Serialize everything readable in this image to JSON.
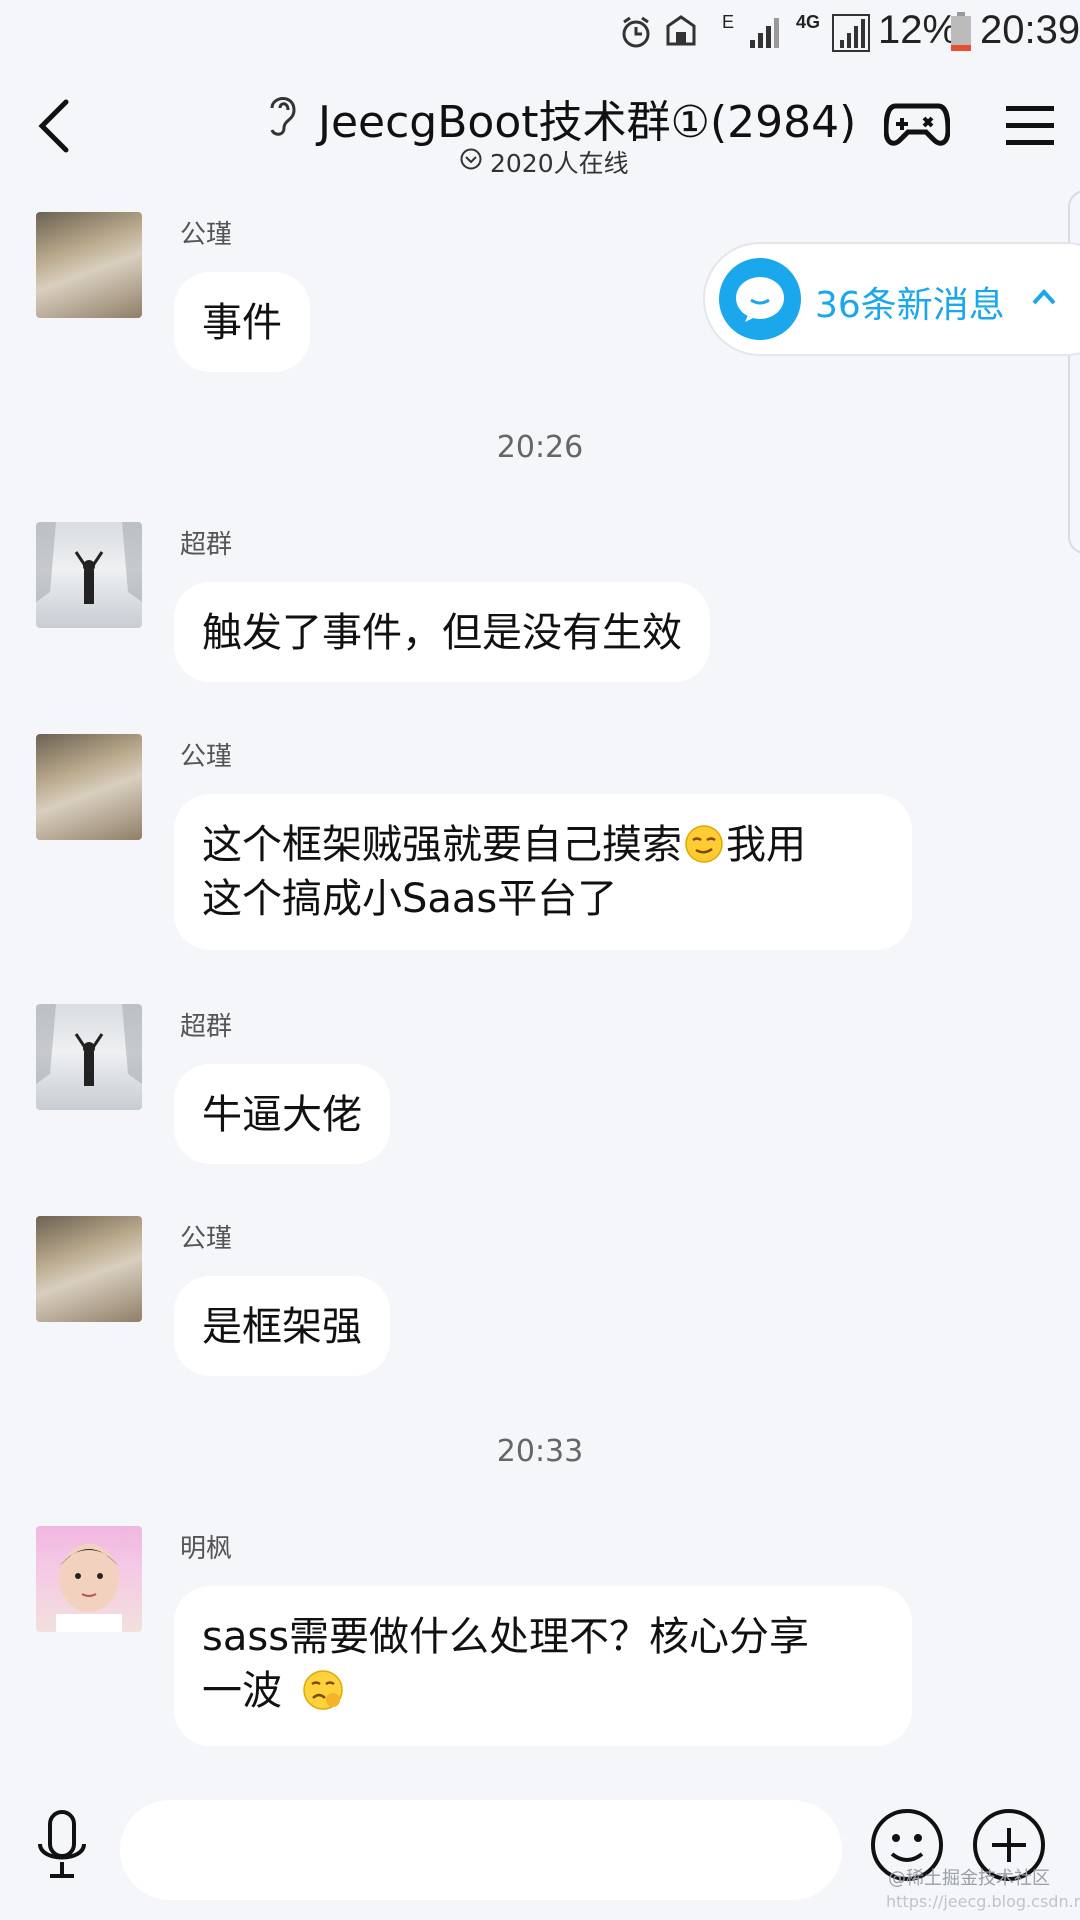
{
  "status_bar": {
    "battery": "12%",
    "time": "20:39",
    "network_e": "E",
    "network_4g": "4G"
  },
  "header": {
    "title": "JeecgBoot技术群①(2984)",
    "online": "2020人在线"
  },
  "new_messages": {
    "label": "36条新消息"
  },
  "messages": [
    {
      "sender": "公瑾",
      "text": "事件"
    },
    {
      "time": "20:26"
    },
    {
      "sender": "超群",
      "text": "触发了事件，但是没有生效"
    },
    {
      "sender": "公瑾",
      "line1": "这个框架贼强就要自己摸索",
      "line1b": "我用",
      "line2": "这个搞成小Saas平台了"
    },
    {
      "sender": "超群",
      "text": "牛逼大佬"
    },
    {
      "sender": "公瑾",
      "text": "是框架强"
    },
    {
      "time": "20:33"
    },
    {
      "sender": "明枫",
      "line1": "sass需要做什么处理不？核心分享",
      "line2": "一波"
    }
  ],
  "input": {
    "value": ""
  },
  "watermark": {
    "line1": "@稀土掘金技术社区",
    "line2": "https://jeecg.blog.csdn.net"
  },
  "colors": {
    "accent": "#1ba7ec",
    "background": "#f4f6f9",
    "bubble": "#ffffff"
  }
}
